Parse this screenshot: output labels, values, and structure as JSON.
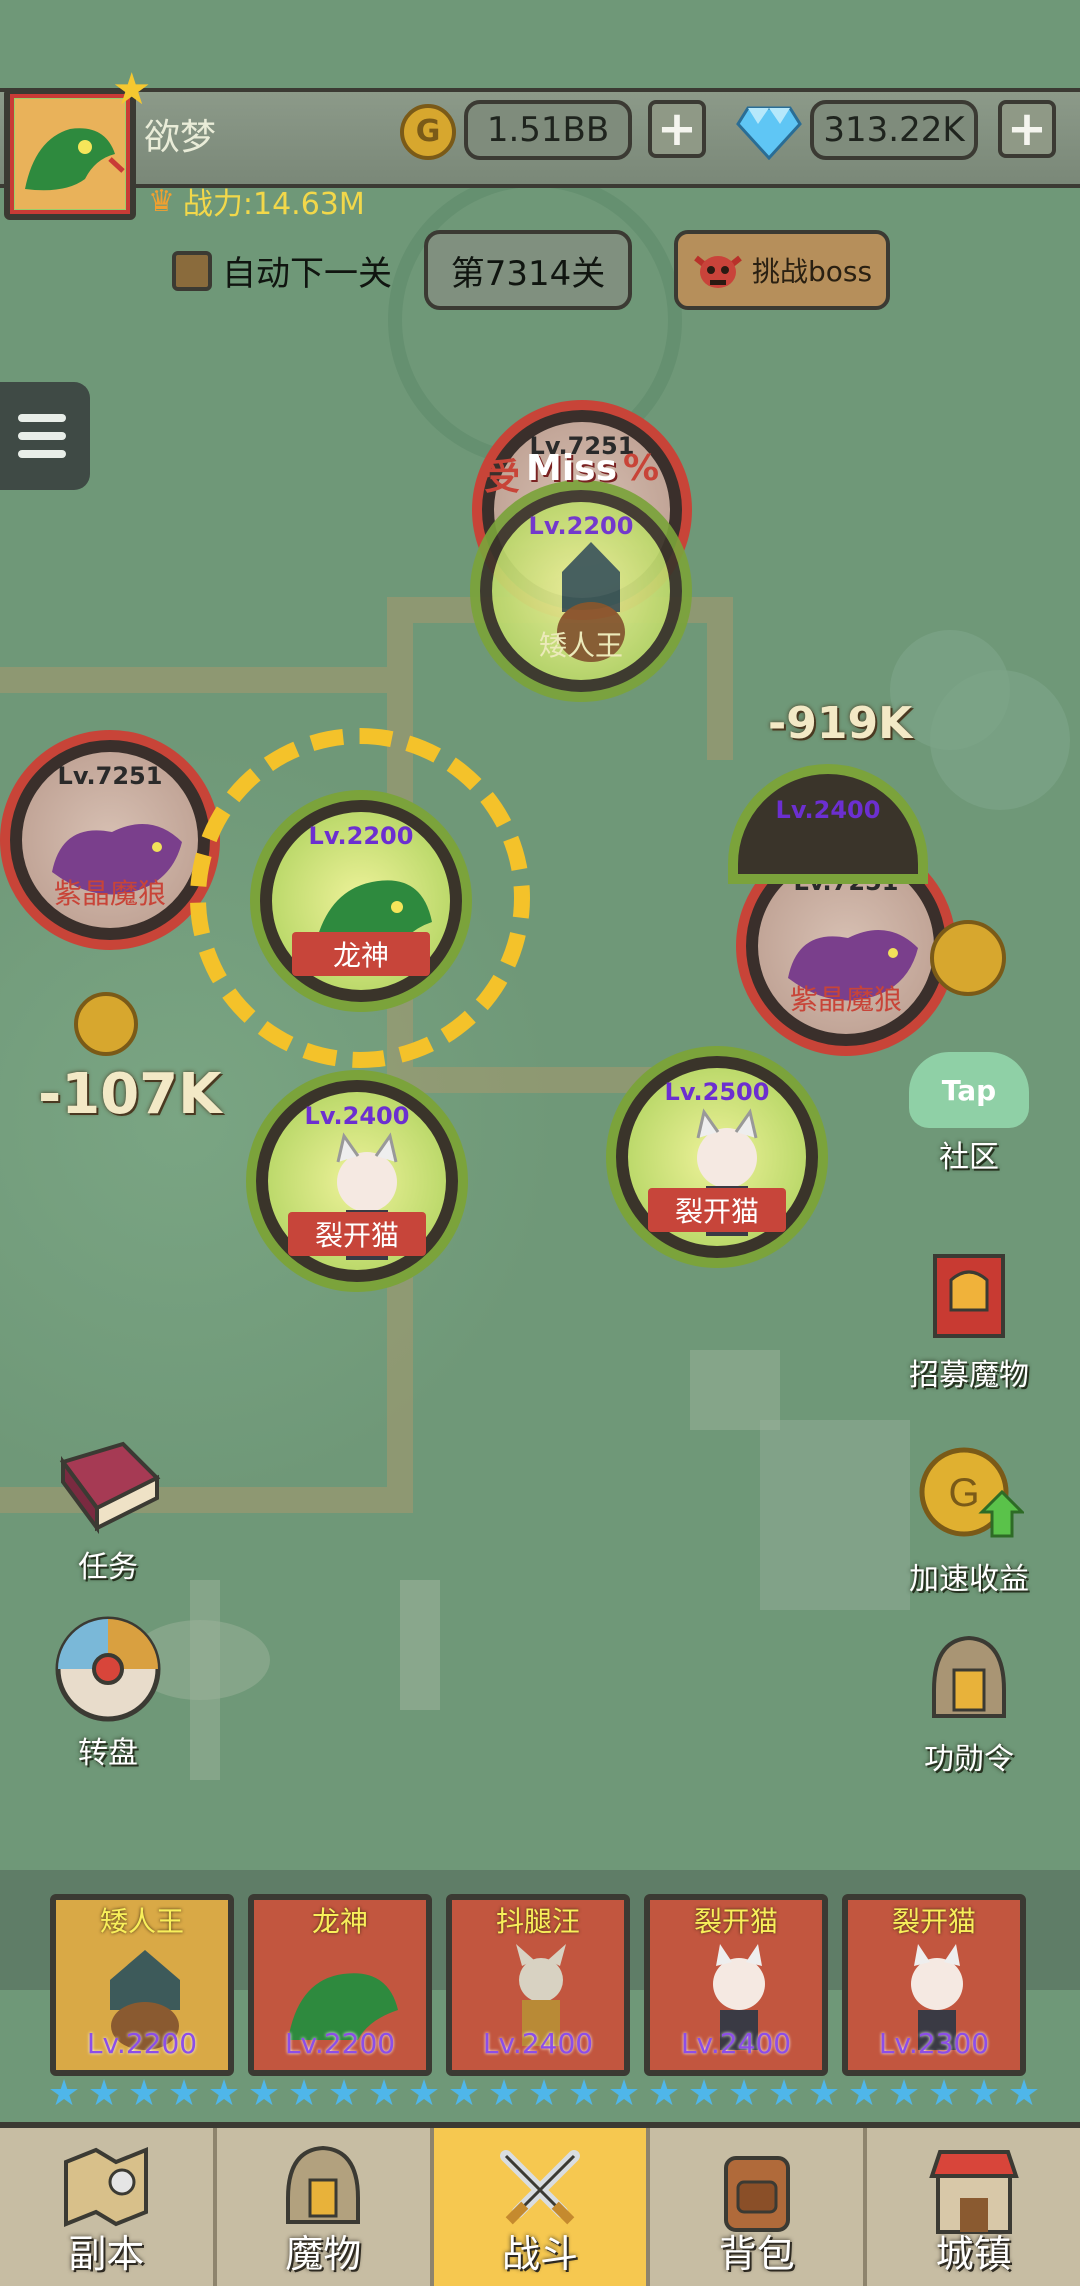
{
  "player": {
    "name": "欲梦",
    "power_label": "战力:14.63M"
  },
  "currency": {
    "gold": "1.51BB",
    "gems": "313.22K",
    "gold_plus": "+",
    "gems_plus": "+"
  },
  "stage": {
    "auto_next_label": "自动下一关",
    "stage_label": "第7314关",
    "challenge_boss": "挑战boss"
  },
  "battle": {
    "enemies": [
      {
        "level": "Lv.7251",
        "name": ""
      },
      {
        "level": "Lv.7251",
        "name": "紫晶魔狼"
      },
      {
        "level": "Lv.7251",
        "name": "紫晶魔狼"
      }
    ],
    "allies": [
      {
        "level": "Lv.2200",
        "name": "矮人王"
      },
      {
        "level": "Lv.2200",
        "name": "龙神"
      },
      {
        "level": "Lv.2400",
        "name": "裂开猫"
      },
      {
        "level": "Lv.2500",
        "name": "裂开猫"
      },
      {
        "level": "Lv.2400",
        "name": ""
      }
    ],
    "floating_texts": {
      "miss": "Miss",
      "miss_prefix": "受",
      "miss_suffix": "%",
      "dmg_1": "-919K",
      "dmg_2": "-107K"
    }
  },
  "side_buttons": {
    "community": "社区",
    "tap": "Tap",
    "recruit": "招募魔物",
    "boost": "加速收益",
    "merit": "功勋令",
    "quest": "任务",
    "wheel": "转盘"
  },
  "team": [
    {
      "name": "矮人王",
      "level": "Lv.2200"
    },
    {
      "name": "龙神",
      "level": "Lv.2200"
    },
    {
      "name": "抖腿汪",
      "level": "Lv.2400"
    },
    {
      "name": "裂开猫",
      "level": "Lv.2400"
    },
    {
      "name": "裂开猫",
      "level": "Lv.2300"
    }
  ],
  "nav": {
    "dungeon": "副本",
    "monsters": "魔物",
    "battle": "战斗",
    "bag": "背包",
    "town": "城镇"
  },
  "colors": {
    "accent_gold": "#f6c850",
    "enemy_ring": "#c84438",
    "ally_ring": "#7ba33b",
    "level_purple": "#6c2fd0",
    "star_blue": "#4fb6ea"
  }
}
